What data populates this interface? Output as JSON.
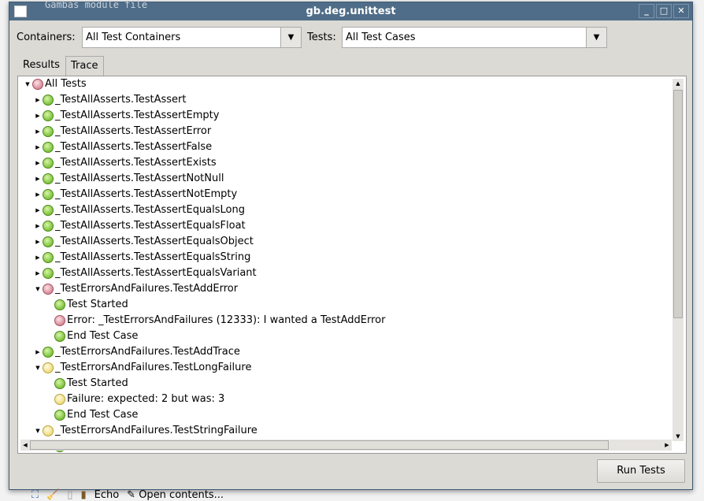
{
  "background": {
    "text": "Gambas module file",
    "taskbar": {
      "echo": "Echo",
      "open": "Open contents..."
    }
  },
  "window": {
    "title": "gb.deg.unittest"
  },
  "filters": {
    "containers_label": "Containers:",
    "containers_value": "All Test Containers",
    "tests_label": "Tests:",
    "tests_value": "All Test Cases"
  },
  "tabs": [
    {
      "label": "Results",
      "active": false
    },
    {
      "label": "Trace",
      "active": true
    }
  ],
  "tree": [
    {
      "text": "All Tests",
      "level": 0,
      "status": "fail",
      "toggle": "expanded"
    },
    {
      "text": "_TestAllAsserts.TestAssert",
      "level": 1,
      "status": "pass",
      "toggle": "collapsed"
    },
    {
      "text": "_TestAllAsserts.TestAssertEmpty",
      "level": 1,
      "status": "pass",
      "toggle": "collapsed"
    },
    {
      "text": "_TestAllAsserts.TestAssertError",
      "level": 1,
      "status": "pass",
      "toggle": "collapsed"
    },
    {
      "text": "_TestAllAsserts.TestAssertFalse",
      "level": 1,
      "status": "pass",
      "toggle": "collapsed"
    },
    {
      "text": "_TestAllAsserts.TestAssertExists",
      "level": 1,
      "status": "pass",
      "toggle": "collapsed"
    },
    {
      "text": "_TestAllAsserts.TestAssertNotNull",
      "level": 1,
      "status": "pass",
      "toggle": "collapsed"
    },
    {
      "text": "_TestAllAsserts.TestAssertNotEmpty",
      "level": 1,
      "status": "pass",
      "toggle": "collapsed"
    },
    {
      "text": "_TestAllAsserts.TestAssertEqualsLong",
      "level": 1,
      "status": "pass",
      "toggle": "collapsed"
    },
    {
      "text": "_TestAllAsserts.TestAssertEqualsFloat",
      "level": 1,
      "status": "pass",
      "toggle": "collapsed"
    },
    {
      "text": "_TestAllAsserts.TestAssertEqualsObject",
      "level": 1,
      "status": "pass",
      "toggle": "collapsed"
    },
    {
      "text": "_TestAllAsserts.TestAssertEqualsString",
      "level": 1,
      "status": "pass",
      "toggle": "collapsed"
    },
    {
      "text": "_TestAllAsserts.TestAssertEqualsVariant",
      "level": 1,
      "status": "pass",
      "toggle": "collapsed"
    },
    {
      "text": "_TestErrorsAndFailures.TestAddError",
      "level": 1,
      "status": "fail",
      "toggle": "expanded"
    },
    {
      "text": "Test Started",
      "level": 2,
      "status": "pass",
      "toggle": ""
    },
    {
      "text": "Error: _TestErrorsAndFailures (12333): I wanted a TestAddError",
      "level": 2,
      "status": "fail",
      "toggle": ""
    },
    {
      "text": "End Test Case",
      "level": 2,
      "status": "pass",
      "toggle": ""
    },
    {
      "text": "_TestErrorsAndFailures.TestAddTrace",
      "level": 1,
      "status": "pass",
      "toggle": "collapsed"
    },
    {
      "text": "_TestErrorsAndFailures.TestLongFailure",
      "level": 1,
      "status": "warn",
      "toggle": "expanded"
    },
    {
      "text": "Test Started",
      "level": 2,
      "status": "pass",
      "toggle": ""
    },
    {
      "text": "Failure:  expected: 2 but was: 3",
      "level": 2,
      "status": "warn",
      "toggle": ""
    },
    {
      "text": "End Test Case",
      "level": 2,
      "status": "pass",
      "toggle": ""
    },
    {
      "text": "_TestErrorsAndFailures.TestStringFailure",
      "level": 1,
      "status": "warn",
      "toggle": "expanded"
    },
    {
      "text": "",
      "level": 2,
      "status": "pass",
      "toggle": ""
    }
  ],
  "run_button": "Run Tests"
}
